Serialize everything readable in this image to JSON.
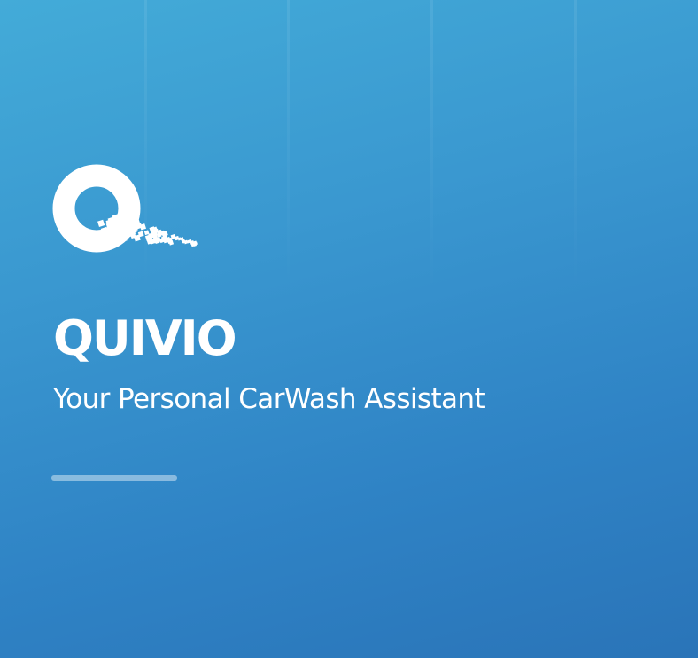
{
  "splash": {
    "brand_name": "QUIVIO",
    "tagline": "Your Personal CarWash Assistant",
    "logo_icon": "quivio-q-logo-icon",
    "loading_progress": 1.0
  },
  "colors": {
    "background_top": "#43abd8",
    "background_bottom": "#2a74b8",
    "text": "#ffffff"
  }
}
